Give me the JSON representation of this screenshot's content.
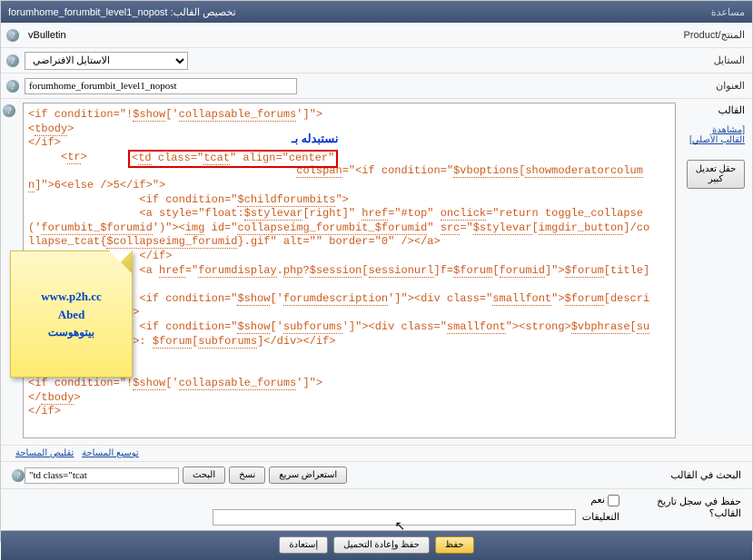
{
  "header": {
    "title_prefix": "تخصيص القالب:",
    "title_value": "forumhome_forumbit_level1_nopost",
    "help": "مساعدة"
  },
  "product": {
    "label": "المنتج/Product",
    "value": "vBulletin"
  },
  "style": {
    "label": "الستايل",
    "selected": "الاستايل الافتراضي"
  },
  "titlef": {
    "label": "العنوان",
    "value": "forumhome_forumbit_level1_nopost"
  },
  "template": {
    "label": "القالب",
    "view_original": "[مشاهدة القالب الأصلي]",
    "big_edit_btn": "حقل تعديل كبير",
    "annotation": "نستبدله بـ",
    "highlighted": "<td class=\"tcat\" align=\"center\"",
    "code": "<if condition=\"!$show['collapsable_forums']\">\n<tbody>\n</if>\n     <tr>\n         <td class=\"tcat\" align=\"center\" colspan=\"<if condition=\"$vboptions[showmoderatorcolumn]\">6<else />5</if>\">\n                 <if condition=\"$childforumbits\">\n                 <a style=\"float:$stylevar[right]\" href=\"#top\" onclick=\"return toggle_collapse('forumbit_$forumid')\"><img id=\"collapseimg_forumbit_$forumid\" src=\"$stylevar[imgdir_button]/collapse_tcat{$collapseimg_forumid}.gif\" alt=\"\" border=\"0\" /></a>\n                 </if>\n                 <a href=\"forumdisplay.php?$session[sessionurl]f=$forum[forumid]\">$forum[title]</a>\n                 <if condition=\"$show['forumdescription']\"><div class=\"smallfont\">$forum[description]</div></if>\n                 <if condition=\"$show['subforums']\"><div class=\"smallfont\"><strong>$vbphrase[subforums]</strong>: $forum[subforums]</div></if>\n         </td>\n     </tr>\n<if condition=\"!$show['collapsable_forums']\">\n</tbody>\n</if>"
  },
  "links": {
    "expand": "توسيع المساحة",
    "shrink": "تقليص المساحة"
  },
  "search": {
    "label": "البحث في القالب",
    "value": "\"td class=\"tcat",
    "btn_search": "البحث",
    "btn_copy": "نسخ",
    "btn_quick": "استعراض سريع"
  },
  "history": {
    "label": "حفظ في سجل تاريخ القالب؟",
    "yes": "نعم",
    "comments": "التعليقات"
  },
  "footer": {
    "save": "حفظ",
    "save_reload": "حفظ وإعادة التحميل",
    "restore": "إستعادة"
  },
  "sticky": {
    "l1": "www.p2h.cc",
    "l2": "Abed",
    "l3": "بيتوهوست"
  }
}
